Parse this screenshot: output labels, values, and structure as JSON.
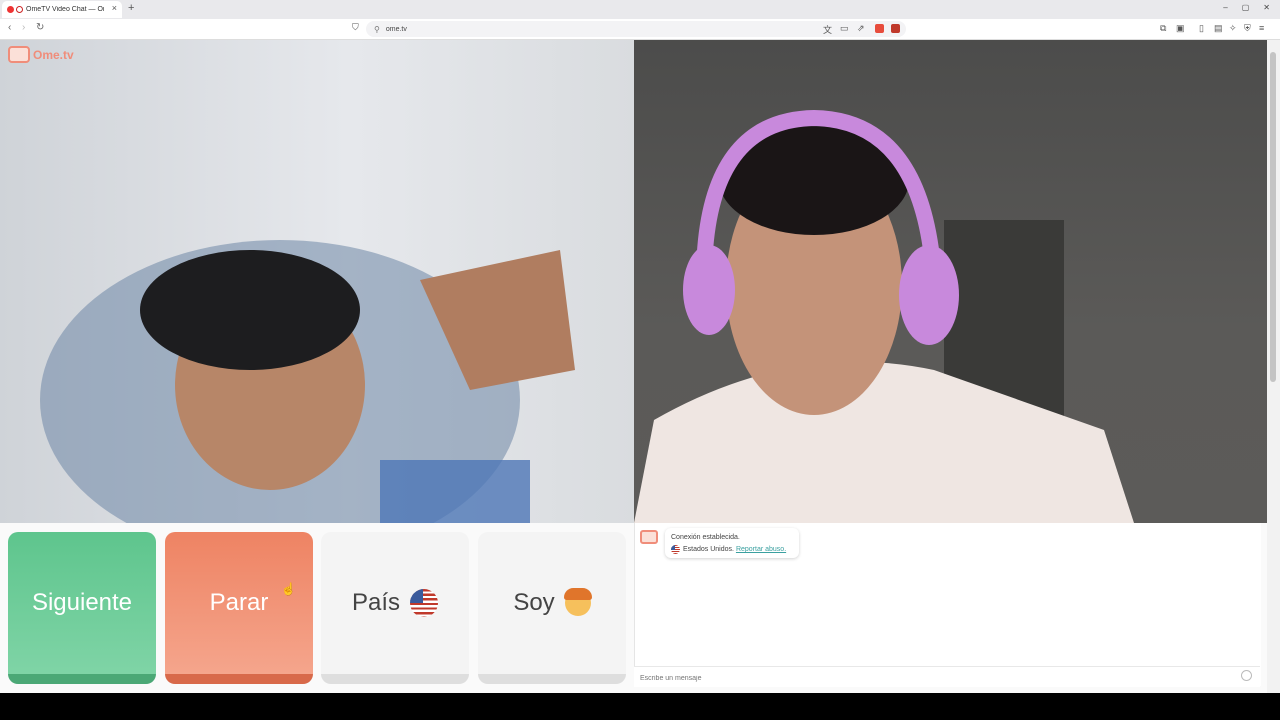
{
  "browser": {
    "tab_title": "OmeTV Video Chat — Omegle",
    "tab_close": "×",
    "new_tab": "+",
    "url": "ome.tv",
    "window_buttons": [
      "–",
      "▢",
      "✕"
    ]
  },
  "logo": {
    "text": "Ome.tv"
  },
  "buttons": {
    "next_label": "Siguiente",
    "stop_label": "Parar",
    "country_label": "País",
    "soy_label": "Soy"
  },
  "chat": {
    "system_line1": "Conexión establecida.",
    "system_country": "Estados Unidos.",
    "report_link": "Reportar abuso.",
    "input_placeholder": "Escribe un mensaje"
  },
  "colors": {
    "next_green": "#5ec58d",
    "stop_orange": "#ee8363",
    "brand": "#f08d7a"
  },
  "icons": [
    "back-icon",
    "forward-icon",
    "reload-icon",
    "bookmark-icon",
    "translate-icon",
    "cast-icon",
    "share-icon",
    "extension-icon",
    "emoji-icon",
    "us-flag-icon",
    "face-icon"
  ]
}
